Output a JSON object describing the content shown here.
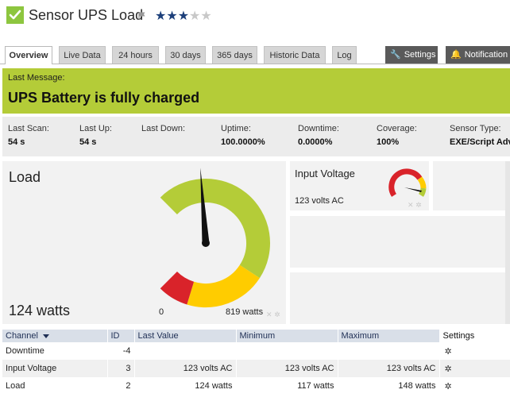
{
  "header": {
    "title": "Sensor UPS Load",
    "rating": 3,
    "rating_max": 5,
    "status_color": "#8dc63f"
  },
  "tabs": [
    {
      "label": "Overview",
      "active": true
    },
    {
      "label": "Live Data"
    },
    {
      "label": "24 hours"
    },
    {
      "label": "30 days"
    },
    {
      "label": "365 days"
    },
    {
      "label": "Historic Data"
    },
    {
      "label": "Log"
    }
  ],
  "actions": {
    "settings": {
      "label": "Settings",
      "icon": "wrench-icon"
    },
    "notifications": {
      "label": "Notification",
      "icon": "bell-icon"
    }
  },
  "message": {
    "label": "Last Message:",
    "text": "UPS Battery is fully charged",
    "color": "#b4cc38"
  },
  "stats": [
    {
      "label": "Last Scan:",
      "value": "54 s"
    },
    {
      "label": "Last Up:",
      "value": "54 s"
    },
    {
      "label": "Last Down:",
      "value": ""
    },
    {
      "label": "Uptime:",
      "value": "100.0000%"
    },
    {
      "label": "Downtime:",
      "value": "0.0000%"
    },
    {
      "label": "Coverage:",
      "value": "100%"
    },
    {
      "label": "Sensor Type:",
      "value": "EXE/Script Adv"
    }
  ],
  "load_gauge": {
    "title": "Load",
    "value_text": "124 watts",
    "value": 124,
    "min": 0,
    "max": 819,
    "min_label": "0",
    "max_label": "819 watts",
    "colors": {
      "ok": "#b4cc38",
      "warning": "#ffcc00",
      "error": "#d9232a"
    }
  },
  "voltage_gauge": {
    "title": "Input Voltage",
    "value_text": "123 volts AC",
    "value": 123
  },
  "table": {
    "headers": [
      "Channel",
      "ID",
      "Last Value",
      "Minimum",
      "Maximum",
      "Settings"
    ],
    "rows": [
      {
        "channel": "Downtime",
        "id": "-4",
        "last": "",
        "min": "",
        "max": ""
      },
      {
        "channel": "Input Voltage",
        "id": "3",
        "last": "123 volts AC",
        "min": "123 volts AC",
        "max": "123 volts AC"
      },
      {
        "channel": "Load",
        "id": "2",
        "last": "124 watts",
        "min": "117 watts",
        "max": "148 watts"
      }
    ]
  }
}
